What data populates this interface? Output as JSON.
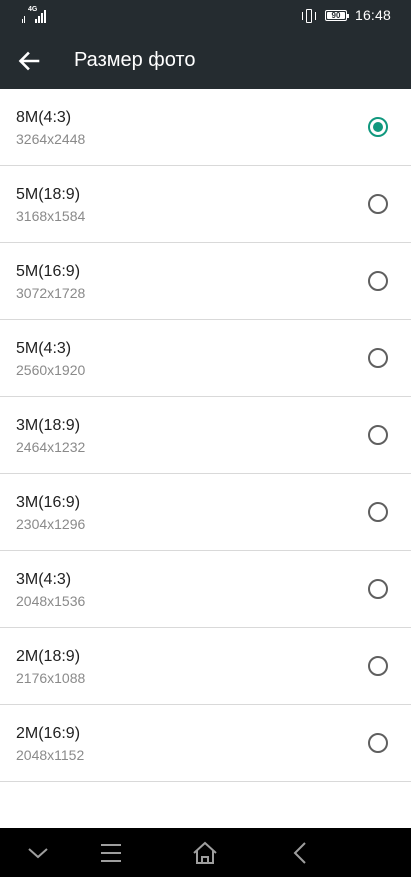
{
  "status_bar": {
    "network": "4G",
    "battery": "90",
    "time": "16:48",
    "icons": [
      "signal-icon",
      "vibrate-icon",
      "battery-icon"
    ]
  },
  "app_bar": {
    "title": "Размер фото",
    "back_icon": "arrow-back-icon",
    "background": "#252c30"
  },
  "options": [
    {
      "label": "8M(4:3)",
      "resolution": "3264x2448",
      "selected": true
    },
    {
      "label": "5M(18:9)",
      "resolution": "3168x1584",
      "selected": false
    },
    {
      "label": "5M(16:9)",
      "resolution": "3072x1728",
      "selected": false
    },
    {
      "label": "5M(4:3)",
      "resolution": "2560x1920",
      "selected": false
    },
    {
      "label": "3M(18:9)",
      "resolution": "2464x1232",
      "selected": false
    },
    {
      "label": "3M(16:9)",
      "resolution": "2304x1296",
      "selected": false
    },
    {
      "label": "3M(4:3)",
      "resolution": "2048x1536",
      "selected": false
    },
    {
      "label": "2M(18:9)",
      "resolution": "2176x1088",
      "selected": false
    },
    {
      "label": "2M(16:9)",
      "resolution": "2048x1152",
      "selected": false
    }
  ],
  "accent_color": "#10987e",
  "nav_bar": {
    "icons": [
      "chevron-down-icon",
      "menu-icon",
      "home-icon",
      "back-icon"
    ]
  }
}
